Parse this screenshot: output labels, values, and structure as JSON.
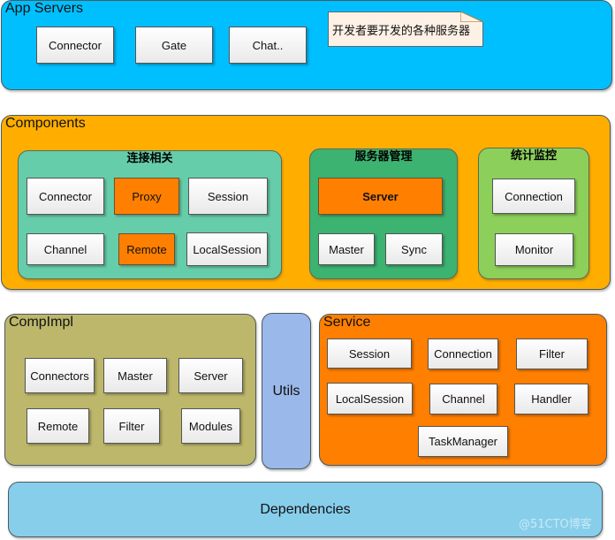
{
  "colors": {
    "app_servers": "#00bfff",
    "components": "#ffae00",
    "connection_group": "#66cdaa",
    "server_mgmt_group": "#3cb371",
    "stats_group": "#8ccf5a",
    "compimpl": "#bdb76b",
    "utils": "#9bb8ea",
    "service": "#ff7f00",
    "dependencies": "#87ceeb",
    "highlight_box": "#ff7f00",
    "note": "#fdf1e6"
  },
  "app_servers": {
    "title": "App Servers",
    "items": [
      "Connector",
      "Gate",
      "Chat.."
    ],
    "note": "开发者要开发的各种服务器"
  },
  "components": {
    "title": "Components",
    "connection": {
      "title": "连接相关",
      "items": [
        {
          "label": "Connector",
          "highlight": false
        },
        {
          "label": "Proxy",
          "highlight": true
        },
        {
          "label": "Session",
          "highlight": false
        },
        {
          "label": "Channel",
          "highlight": false
        },
        {
          "label": "Remote",
          "highlight": true
        },
        {
          "label": "LocalSession",
          "highlight": false
        }
      ]
    },
    "server_mgmt": {
      "title": "服务器管理",
      "items": [
        {
          "label": "Server",
          "highlight": true
        },
        {
          "label": "Master",
          "highlight": false
        },
        {
          "label": "Sync",
          "highlight": false
        }
      ]
    },
    "stats": {
      "title": "统计监控",
      "items": [
        "Connection",
        "Monitor"
      ]
    }
  },
  "compimpl": {
    "title": "CompImpl",
    "items": [
      "Connectors",
      "Master",
      "Server",
      "Remote",
      "Filter",
      "Modules"
    ]
  },
  "utils": {
    "title": "Utils"
  },
  "service": {
    "title": "Service",
    "items": [
      "Session",
      "Connection",
      "Filter",
      "LocalSession",
      "Channel",
      "Handler",
      "TaskManager"
    ]
  },
  "dependencies": {
    "title": "Dependencies"
  },
  "watermark": "@51CTO博客"
}
